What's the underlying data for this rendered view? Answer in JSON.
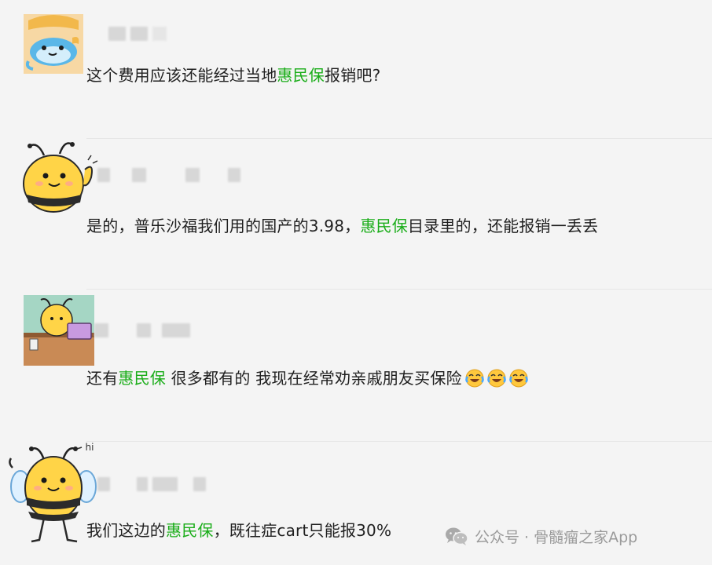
{
  "comments": [
    {
      "avatar": "cartoon-fish-avatar",
      "segments": [
        "这个费用应该还能经过当地",
        "惠民保",
        "报销吧?"
      ]
    },
    {
      "avatar": "bee-waving-avatar",
      "segments": [
        "是的，普乐沙福我们用的国产的3.98，",
        "惠民保",
        "目录里的，还能报销一丢丢"
      ]
    },
    {
      "avatar": "bee-at-laptop-avatar",
      "segments": [
        "还有",
        "惠民保",
        " 很多都有的 我现在经常劝亲戚朋友买保险"
      ],
      "emojis": [
        "laugh-cry-emoji",
        "laugh-cry-emoji",
        "laugh-cry-emoji"
      ]
    },
    {
      "avatar": "bee-hi-avatar",
      "avatar_text": "hi",
      "segments": [
        "我们这边的",
        "惠民保",
        "，既往症cart只能报30%"
      ]
    }
  ],
  "watermark": {
    "icon": "wechat-icon",
    "text": "公众号 · 骨髓瘤之家App"
  },
  "colors": {
    "highlight": "#1aad19",
    "text": "#1f1f1f",
    "background": "#f4f4f4",
    "watermark": "#9a9a9a"
  }
}
